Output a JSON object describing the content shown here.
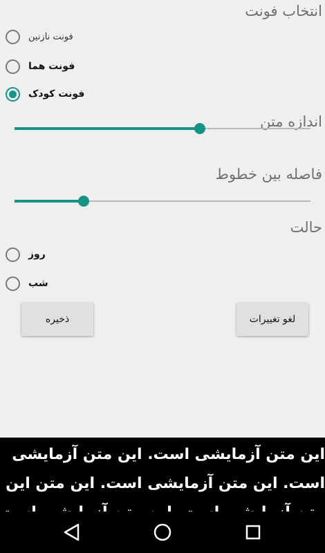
{
  "font_section": {
    "title": "انتخاب فونت",
    "options": [
      {
        "label": "فونت نازنین",
        "checked": false
      },
      {
        "label": "فونت هما",
        "checked": false
      },
      {
        "label": "فونت کودک",
        "checked": true
      }
    ]
  },
  "text_size": {
    "title": "اندازه متن",
    "value_fraction": 0.625
  },
  "line_spacing": {
    "title": "فاصله بین خطوط",
    "value_fraction": 0.233
  },
  "mode_section": {
    "title": "حالت",
    "options": [
      {
        "label": "روز",
        "checked": false
      },
      {
        "label": "شب",
        "checked": false
      }
    ]
  },
  "buttons": {
    "save": "ذخیره",
    "cancel": "لغو تغییرات"
  },
  "preview": {
    "text": "این متن آزمایشی است. این متن آزمایشی است. این متن آزمایشی است. این متن این متن آزمایشی است. این متن آزمایشی است."
  },
  "colors": {
    "accent": "#139486",
    "background": "#efefef",
    "preview_background": "#000000",
    "preview_text": "#ffffff"
  },
  "navbar": {
    "icons": [
      "back-icon",
      "home-icon",
      "recents-icon"
    ]
  }
}
